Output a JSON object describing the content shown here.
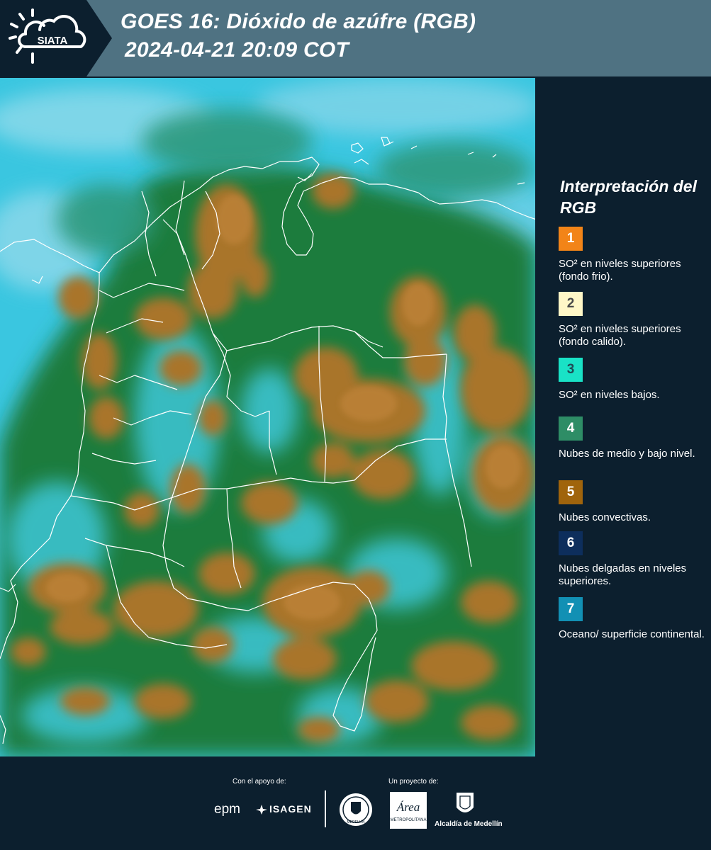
{
  "header": {
    "logo_text": "SIATA",
    "title_line1": "GOES 16: Dióxido de azúfre (RGB)",
    "title_line2": "2024-04-21 20:09 COT",
    "bg_color": "#4f7282",
    "logo_bg_color": "#0c1f2e"
  },
  "legend": {
    "title": "Interpretación del RGB",
    "items": [
      {
        "number": "1",
        "text": "SO² en niveles superiores (fondo frio).",
        "color": "#f28418",
        "text_color": "#ffffff"
      },
      {
        "number": "2",
        "text": "SO² en niveles superiores (fondo calido).",
        "color": "#fff7c7",
        "text_color": "#4a4a4a"
      },
      {
        "number": "3",
        "text": "SO² en niveles bajos.",
        "color": "#19e2c6",
        "text_color": "#1f4b55"
      },
      {
        "number": "4",
        "text": "Nubes de medio y bajo nivel.",
        "color": "#2e8d66",
        "text_color": "#ffffff"
      },
      {
        "number": "5",
        "text": "Nubes convectivas.",
        "color": "#a0640c",
        "text_color": "#ffffff"
      },
      {
        "number": "6",
        "text": "Nubes delgadas en niveles superiores.",
        "color": "#0d2e5c",
        "text_color": "#ffffff"
      },
      {
        "number": "7",
        "text": "Oceano/ superficie continental.",
        "color": "#1290b4",
        "text_color": "#ffffff"
      }
    ]
  },
  "footer": {
    "support_label": "Con el apoyo de:",
    "project_label": "Un proyecto de:",
    "sponsor1": "epm",
    "sponsor2": "ISAGEN",
    "partner1": "MEDELLÍN",
    "partner2": "Área",
    "partner2_sub": "METROPOLITANA",
    "partner3": "Alcaldía de Medellín"
  },
  "map": {
    "ocean_color": "#37c4df",
    "vegetation_color": "#1d7a3c",
    "cloud_color": "#b07a2e",
    "border_color": "#ffffff"
  }
}
